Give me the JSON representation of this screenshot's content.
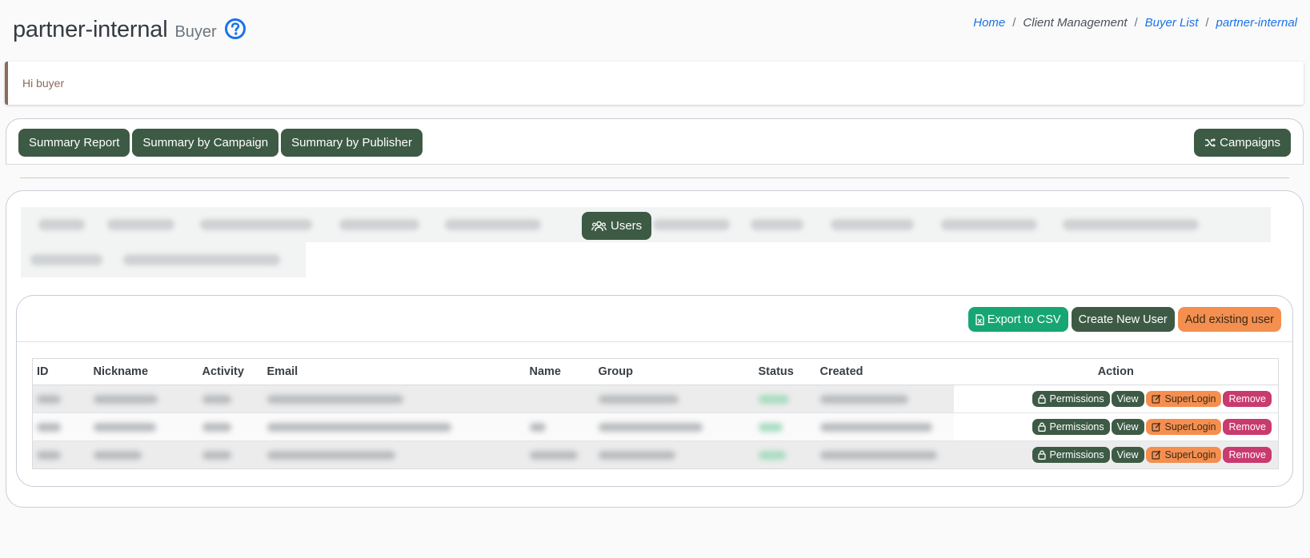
{
  "header": {
    "title": "partner-internal",
    "subtitle": "Buyer",
    "help_icon": "question-circle-icon"
  },
  "breadcrumb": {
    "items": [
      {
        "label": "Home",
        "link": true
      },
      {
        "label": "Client Management",
        "link": false
      },
      {
        "label": "Buyer List",
        "link": true
      },
      {
        "label": "partner-internal",
        "link": true
      }
    ],
    "separator": "/"
  },
  "alert": {
    "text": "Hi buyer"
  },
  "report_bar": {
    "summary_report": "Summary Report",
    "summary_by_campaign": "Summary by Campaign",
    "summary_by_publisher": "Summary by Publisher",
    "campaigns": "Campaigns",
    "campaigns_icon": "shuffle-icon"
  },
  "tabs": {
    "active_label": "Users",
    "active_icon": "users-icon"
  },
  "users_card": {
    "export_csv": "Export to CSV",
    "export_icon": "file-excel-icon",
    "create_new_user": "Create New User",
    "add_existing_user": "Add existing user"
  },
  "table": {
    "columns": [
      "ID",
      "Nickname",
      "Activity",
      "Email",
      "Name",
      "Group",
      "Status",
      "Created",
      "Action"
    ],
    "row_actions": {
      "permissions": "Permissions",
      "view": "View",
      "superlogin": "SuperLogin",
      "remove": "Remove",
      "permissions_icon": "lock-icon",
      "superlogin_icon": "edit-icon"
    },
    "row_count": 3
  },
  "colors": {
    "primary_dark": "#3d5a45",
    "success": "#17a673",
    "warning": "#f48f4f",
    "danger": "#c93a6e",
    "link": "#1a73e8"
  }
}
